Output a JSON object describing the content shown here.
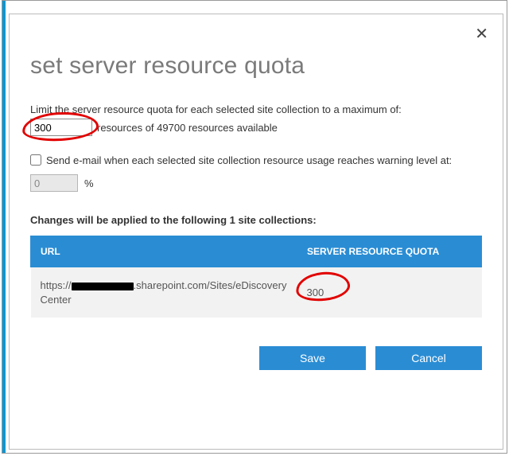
{
  "dialog": {
    "title": "set server resource quota",
    "close_glyph": "✕"
  },
  "limit": {
    "label": "Limit the server resource quota for each selected site collection to a maximum of:",
    "value": "300",
    "after_text": "resources of 49700 resources available"
  },
  "email": {
    "checked": false,
    "label": "Send e-mail when each selected site collection resource usage reaches warning level at:",
    "percent_value": "0",
    "percent_symbol": "%"
  },
  "applied": {
    "heading": "Changes will be applied to the following 1 site collections:",
    "columns": {
      "url": "URL",
      "quota": "SERVER RESOURCE QUOTA"
    },
    "rows": [
      {
        "url_prefix": "https://",
        "url_suffix": ".sharepoint.com/Sites/eDiscovery Center",
        "quota": "300"
      }
    ]
  },
  "buttons": {
    "save": "Save",
    "cancel": "Cancel"
  }
}
